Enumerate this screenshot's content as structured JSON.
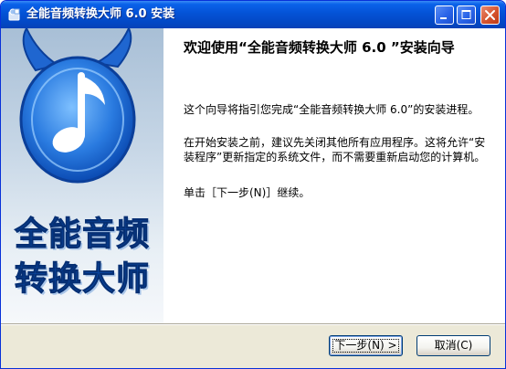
{
  "window": {
    "title": "全能音频转换大师 6.0 安装",
    "icons": {
      "app": "installer-app-icon",
      "minimize": "minimize-icon",
      "maximize": "maximize-icon",
      "close": "close-icon"
    }
  },
  "banner": {
    "logo_icon": "music-note-logo-icon",
    "line1": "全能音频",
    "line2": "转换大师"
  },
  "main": {
    "heading": "欢迎使用“全能音频转换大师 6.0 ”安装向导",
    "paragraph1": "这个向导将指引您完成“全能音频转换大师 6.0”的安装进程。",
    "paragraph2": "在开始安装之前，建议先关闭其他所有应用程序。这将允许“安装程序”更新指定的系统文件，而不需要重新启动您的计算机。",
    "paragraph3": "单击［下一步(N)］继续。"
  },
  "buttons": {
    "next": "下一步(N) >",
    "cancel": "取消(C)"
  },
  "colors": {
    "titlebar": "#0452d6",
    "dialog_face": "#ece9d8",
    "banner_text": "#0a4aa8",
    "logo_blue": "#2a7be0"
  }
}
